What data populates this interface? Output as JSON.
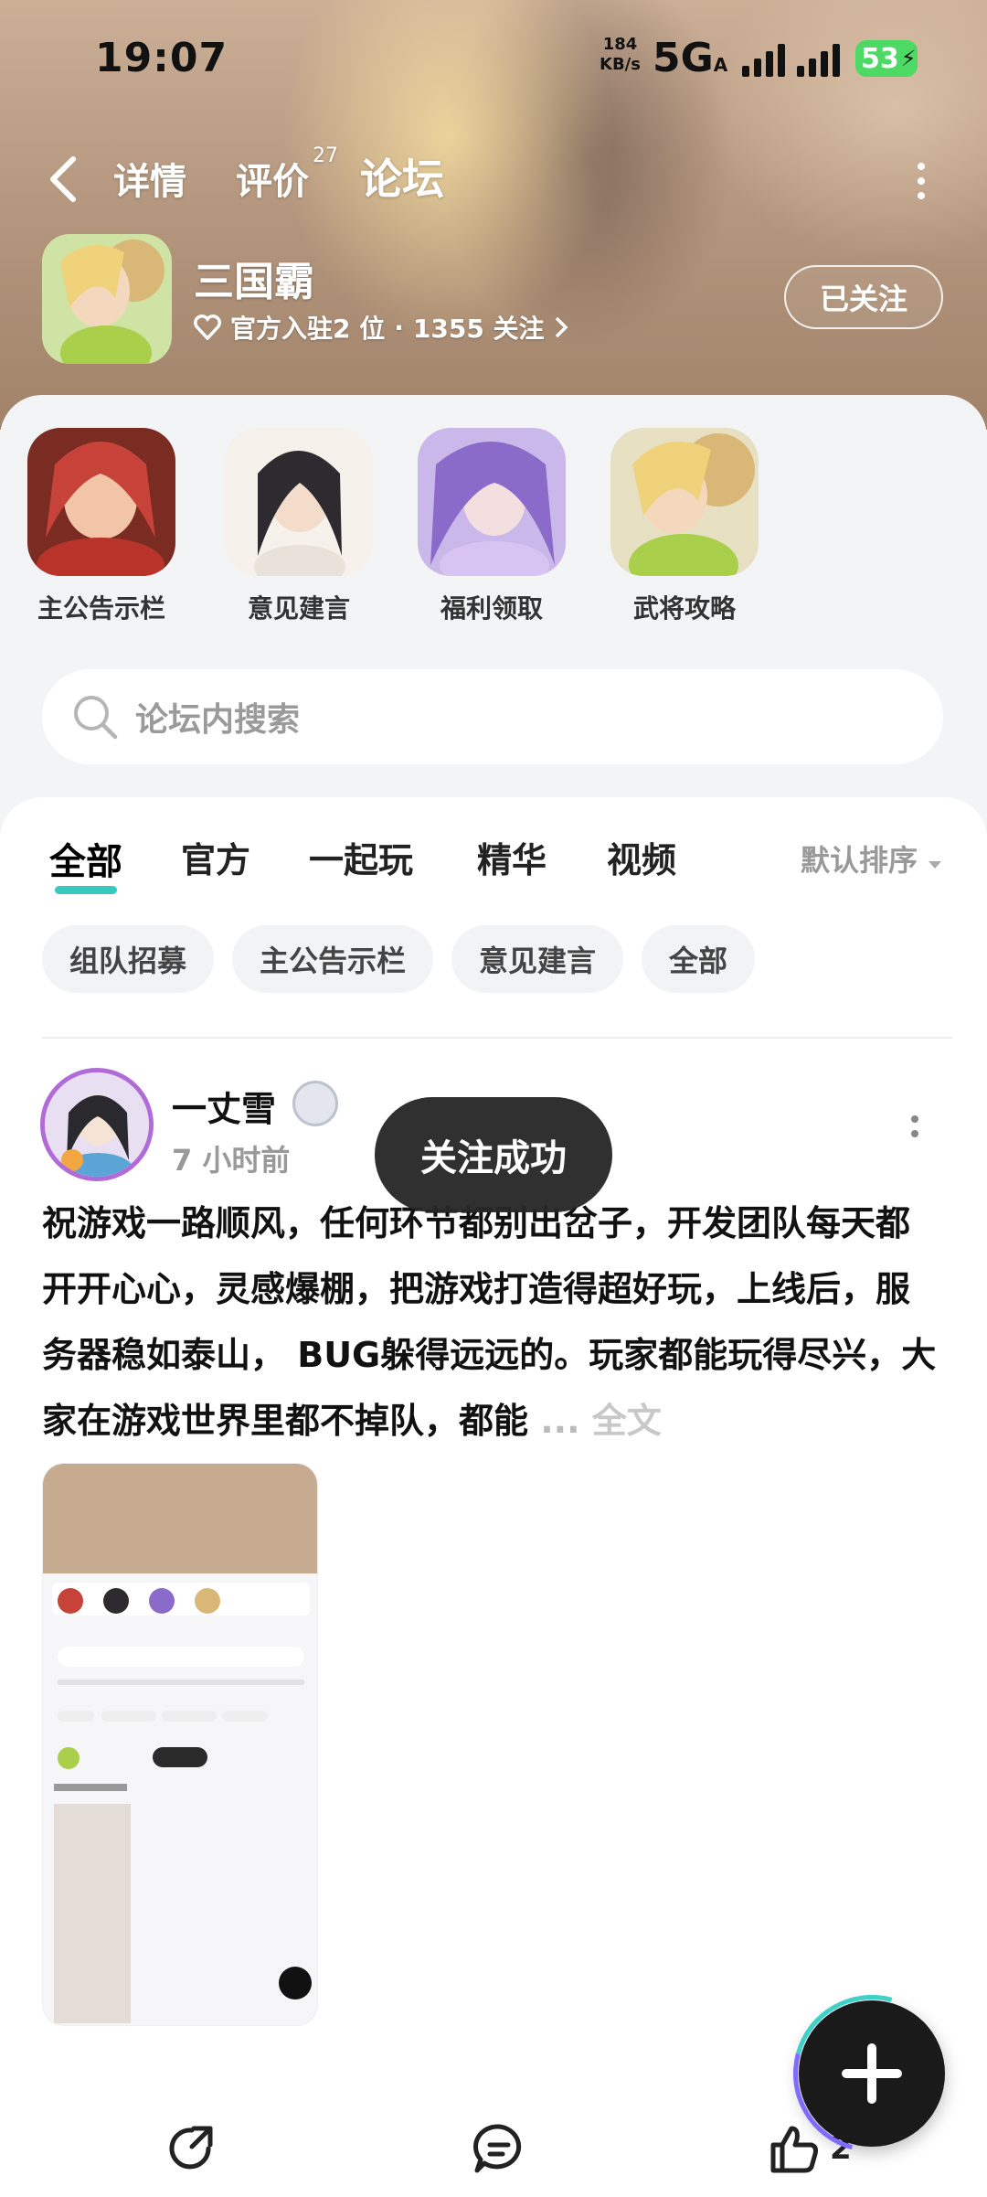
{
  "status_bar": {
    "time": "19:07",
    "net_speed_value": "184",
    "net_speed_unit": "KB/s",
    "network": "5G",
    "network_suffix": "A",
    "battery": "53"
  },
  "nav": {
    "tabs": [
      {
        "label": "详情",
        "sup": ""
      },
      {
        "label": "评价",
        "sup": "27"
      },
      {
        "label": "论坛",
        "sup": ""
      }
    ],
    "active_tab": "论坛"
  },
  "game": {
    "name": "三国霸",
    "meta_official": "官方入驻2 位",
    "meta_sep": "·",
    "meta_followers": "1355 关注",
    "follow_button": "已关注"
  },
  "categories": [
    {
      "label": "主公告示栏",
      "color": "#c7433a"
    },
    {
      "label": "意见建言",
      "color": "#2d2a30"
    },
    {
      "label": "福利领取",
      "color": "#8a6bc9"
    },
    {
      "label": "武将攻略",
      "color": "#d9b45a"
    }
  ],
  "search": {
    "placeholder": "论坛内搜索"
  },
  "feed_tabs": [
    "全部",
    "官方",
    "一起玩",
    "精华",
    "视频"
  ],
  "sort_label": "默认排序",
  "chips": [
    "组队招募",
    "主公告示栏",
    "意见建言",
    "全部"
  ],
  "post": {
    "author": "一丈雪",
    "time": "7 小时前",
    "text": "祝游戏一路顺风，任何环节都别出岔子，开发团队每天都开开心心，灵感爆棚，把游戏打造得超好玩，上线后，服务器稳如泰山， BUG躲得远远的。玩家都能玩得尽兴，大家在游戏世界里都不掉队，都能",
    "ellipsis": "...",
    "full_text_link": "全文"
  },
  "toast": "关注成功",
  "bottom": {
    "like_count": "2"
  },
  "colors": {
    "accent": "#3fd0c8",
    "fab": "#1a1a1a"
  },
  "icons": [
    "back-icon",
    "more-icon",
    "heart-icon",
    "chevron-right-icon",
    "search-icon",
    "share-icon",
    "comment-icon",
    "like-icon",
    "plus-icon"
  ]
}
